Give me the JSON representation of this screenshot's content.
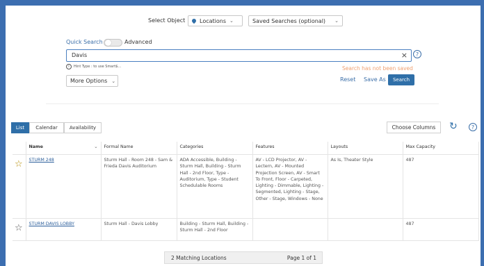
{
  "header": {
    "select_object_label": "Select Object",
    "object_value": "Locations",
    "saved_searches": "Saved Searches (optional)"
  },
  "search": {
    "quick_search_label": "Quick Search",
    "advanced_label": "Advanced",
    "input_value": "Davis",
    "clear_glyph": "×",
    "help_glyph": "?",
    "hint_text": "Hint Type : to use Smart$...",
    "not_saved_text": "Search has not been saved",
    "more_options": "More Options",
    "reset_label": "Reset",
    "save_as_label": "Save As",
    "search_button": "Search"
  },
  "view_tabs": [
    {
      "label": "List",
      "active": true
    },
    {
      "label": "Calendar",
      "active": false
    },
    {
      "label": "Availability",
      "active": false
    }
  ],
  "toolbar": {
    "choose_columns": "Choose Columns",
    "refresh_glyph": "↻",
    "help_glyph": "?"
  },
  "table": {
    "columns": [
      "Name",
      "Formal Name",
      "Categories",
      "Features",
      "Layouts",
      "Max Capacity"
    ],
    "rows": [
      {
        "starred": true,
        "name": "STURM 248",
        "formal_name": "Sturm Hall - Room 248 - Sam & Frieda Davis Auditorium",
        "categories": "ADA Accessible, Building - Sturm Hall, Building - Sturm Hall - 2nd Floor, Type - Auditorium, Type - Student Schedulable Rooms",
        "features": "AV - LCD Projector, AV - Lectern, AV - Mounted Projection Screen, AV - Smart To Front, Floor - Carpeted, Lighting - Dimmable, Lighting - Segmented, Lighting - Stage, Other - Stage, Windows - None",
        "layouts": "As Is, Theater Style",
        "max_capacity": "487"
      },
      {
        "starred": false,
        "name": "STURM DAVIS LOBBY",
        "formal_name": "Sturm Hall - Davis Lobby",
        "categories": "Building - Sturm Hall, Building - Sturm Hall - 2nd Floor",
        "features": "",
        "layouts": "",
        "max_capacity": "487"
      }
    ]
  },
  "footer": {
    "matching_text": "2 Matching Locations",
    "page_text": "Page 1 of 1"
  },
  "colors": {
    "accent": "#2f6fa8",
    "frame": "#3c6eb0",
    "warning": "#f0a070"
  }
}
